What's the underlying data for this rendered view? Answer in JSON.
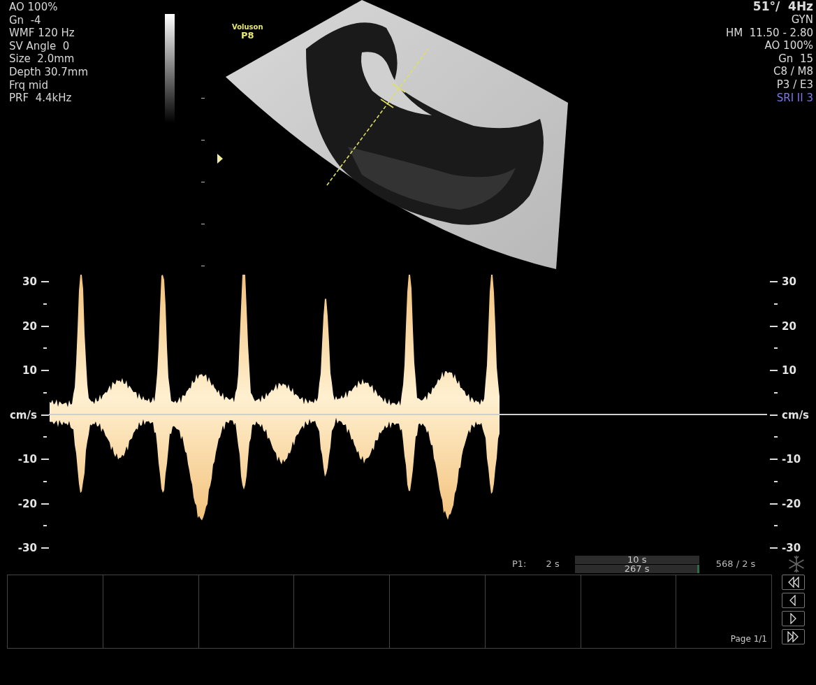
{
  "left_params": [
    "AO 100%",
    "Gn  -4",
    "WMF 120 Hz",
    "SV Angle  0",
    "Size  2.0mm",
    "Depth 30.7mm",
    "Frq mid",
    "PRF  4.4kHz"
  ],
  "logo": {
    "brand": "Voluson",
    "model": "P8"
  },
  "right_params": [
    {
      "text": "51°/  4Hz",
      "kind": "heading",
      "color": "#dcdcdc"
    },
    {
      "text": "GYN",
      "kind": "param",
      "color": "#dcdcdc"
    },
    {
      "text": "HM  11.50 - 2.80",
      "kind": "param",
      "color": "#dcdcdc"
    },
    {
      "text": "AO 100%",
      "kind": "param",
      "color": "#dcdcdc"
    },
    {
      "text": "Gn  15",
      "kind": "param",
      "color": "#dcdcdc"
    },
    {
      "text": "C8 / M8",
      "kind": "param",
      "color": "#dcdcdc"
    },
    {
      "text": "P3 / E3",
      "kind": "param",
      "color": "#dcdcdc"
    },
    {
      "text": "SRI II 3",
      "kind": "param",
      "color": "#7b79e6"
    }
  ],
  "doppler": {
    "left_axis": [
      "30",
      "20",
      "10",
      "cm/s",
      "-10",
      "-20",
      "-30"
    ],
    "right_axis": [
      "30",
      "20",
      "10",
      "cm/s",
      "-10",
      "-20",
      "-30"
    ]
  },
  "cine": {
    "label": "P1:",
    "start": "2 s",
    "bar_top": "10 s",
    "bar_bottom": "267 s",
    "total": "568 / 2 s",
    "level": 1
  },
  "page": "Page 1/1"
}
